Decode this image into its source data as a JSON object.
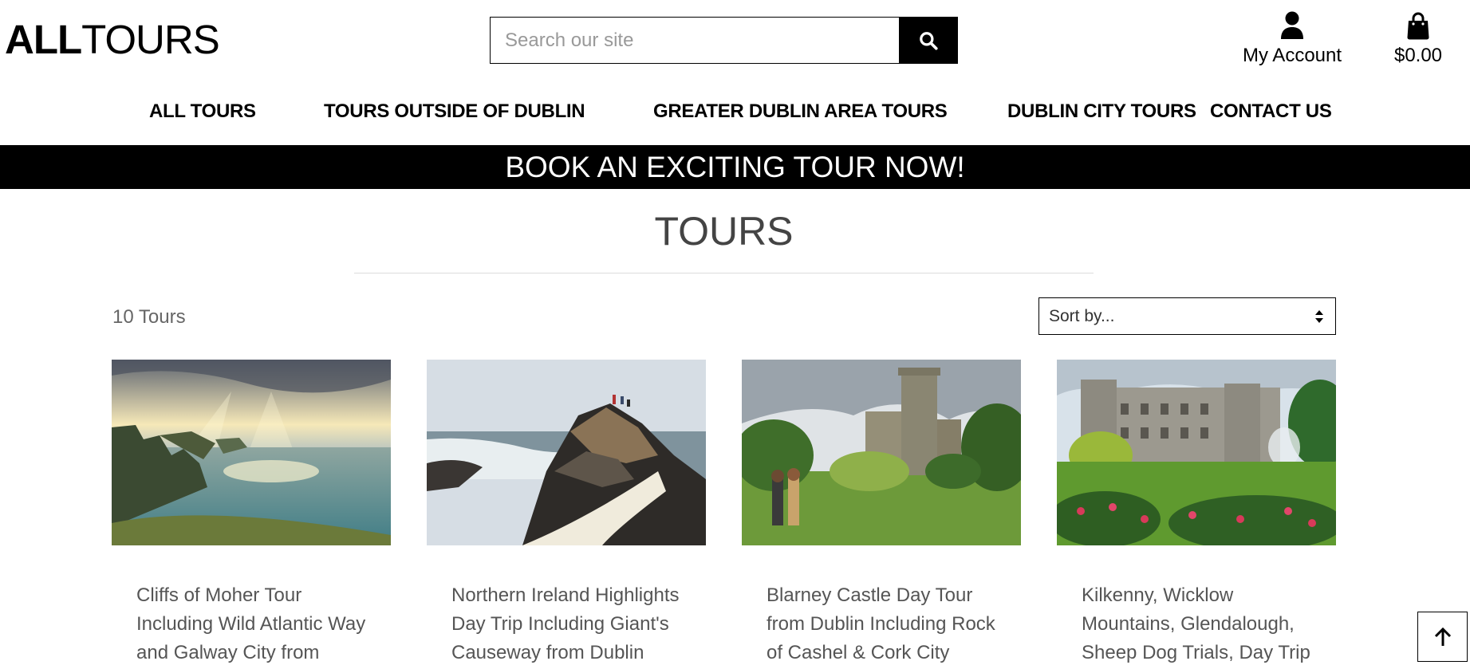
{
  "header": {
    "logo_bold": "ALL",
    "logo_light": "TOURS",
    "search": {
      "placeholder": "Search our site"
    },
    "account_label": "My Account",
    "cart_total": "$0.00"
  },
  "nav": [
    {
      "label": "ALL TOURS"
    },
    {
      "label": "TOURS OUTSIDE OF DUBLIN"
    },
    {
      "label": "GREATER DUBLIN AREA TOURS"
    },
    {
      "label": "DUBLIN CITY TOURS"
    },
    {
      "label": "CONTACT US"
    }
  ],
  "banner": "BOOK AN EXCITING TOUR NOW!",
  "main": {
    "title": "TOURS",
    "count": "10 Tours",
    "sort": {
      "selected": "Sort by..."
    }
  },
  "tours": [
    {
      "name": "Cliffs of Moher Tour Including Wild Atlantic Way and Galway City from Dublin",
      "image": "cliffs-of-moher"
    },
    {
      "name": "Northern Ireland Highlights Day Trip Including Giant's Causeway from Dublin",
      "image": "giants-causeway"
    },
    {
      "name": "Blarney Castle Day Tour from Dublin Including Rock of Cashel & Cork City",
      "image": "blarney-castle"
    },
    {
      "name": "Kilkenny, Wicklow Mountains, Glendalough, Sheep Dog Trials, Day Trip from Dublin",
      "image": "kilkenny-castle"
    }
  ],
  "icons": {
    "search": "search-icon",
    "account": "user-icon",
    "cart": "shopping-bag-icon",
    "sort": "sort-arrows-icon",
    "back_to_top": "arrow-up-icon"
  },
  "colors": {
    "primary": "#000000",
    "banner_text": "#ffffff",
    "title_text": "#444444",
    "muted_text": "#666666",
    "placeholder": "#999999"
  }
}
